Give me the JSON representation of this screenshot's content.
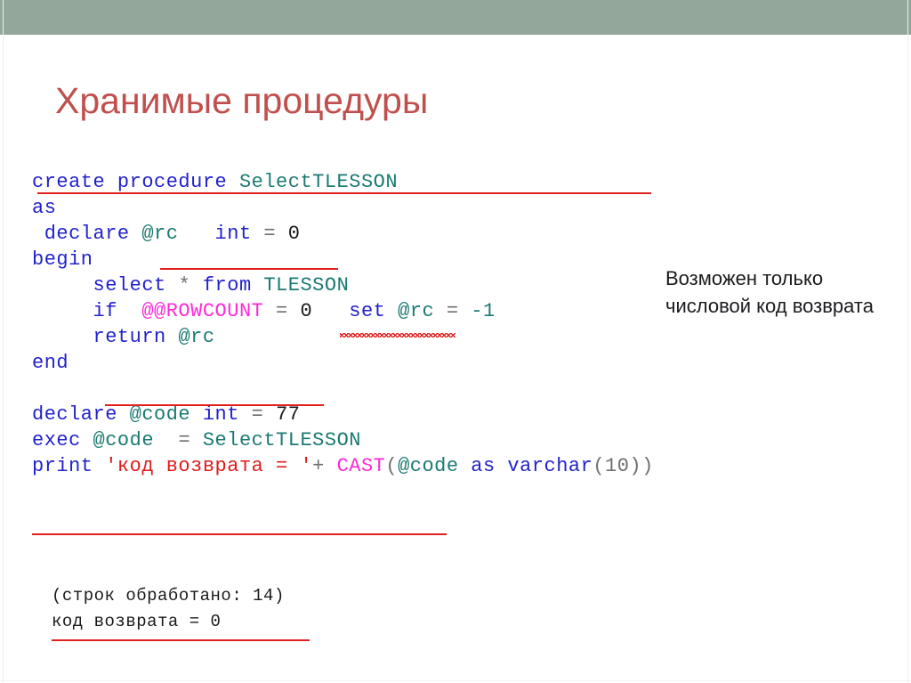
{
  "slide": {
    "title": "Хранимые процедуры",
    "title_color": "#c0504d",
    "band_color": "#93a79b",
    "background": "#ffffff"
  },
  "code": {
    "language": "T-SQL",
    "colors": {
      "keyword": "#2222cc",
      "identifier": "#1a7a72",
      "system_function": "#ff29d7",
      "string": "#e01b1b",
      "number": "#1a1a1a",
      "operator": "#6e6e6e",
      "annotation_underline": "#e02020"
    },
    "lines": [
      {
        "tokens": [
          {
            "t": "create procedure ",
            "c": "kw"
          },
          {
            "t": "SelectTLESSON",
            "c": "ident"
          }
        ]
      },
      {
        "tokens": [
          {
            "t": "as",
            "c": "kw"
          }
        ]
      },
      {
        "tokens": [
          {
            "t": " declare ",
            "c": "kw"
          },
          {
            "t": "@rc",
            "c": "ident"
          },
          {
            "t": "   ",
            "c": "num"
          },
          {
            "t": "int",
            "c": "kw"
          },
          {
            "t": " = ",
            "c": "punc"
          },
          {
            "t": "0",
            "c": "num"
          }
        ]
      },
      {
        "tokens": [
          {
            "t": "begin",
            "c": "kw"
          }
        ]
      },
      {
        "tokens": [
          {
            "t": "     select ",
            "c": "kw"
          },
          {
            "t": "* ",
            "c": "punc"
          },
          {
            "t": "from ",
            "c": "kw"
          },
          {
            "t": "TLESSON",
            "c": "ident"
          }
        ]
      },
      {
        "tokens": [
          {
            "t": "     if  ",
            "c": "kw"
          },
          {
            "t": "@@ROWCOUNT",
            "c": "sysfn"
          },
          {
            "t": " = ",
            "c": "punc"
          },
          {
            "t": "0",
            "c": "num"
          },
          {
            "t": "   ",
            "c": "num"
          },
          {
            "t": "set ",
            "c": "kw"
          },
          {
            "t": "@rc",
            "c": "ident"
          },
          {
            "t": " = ",
            "c": "punc"
          },
          {
            "t": "-1",
            "c": "ident"
          }
        ]
      },
      {
        "tokens": [
          {
            "t": "     return ",
            "c": "kw"
          },
          {
            "t": "@rc",
            "c": "ident"
          }
        ]
      },
      {
        "tokens": [
          {
            "t": "end",
            "c": "kw"
          }
        ]
      },
      {
        "tokens": []
      },
      {
        "tokens": [
          {
            "t": "declare ",
            "c": "kw"
          },
          {
            "t": "@code",
            "c": "ident"
          },
          {
            "t": " ",
            "c": "num"
          },
          {
            "t": "int",
            "c": "kw"
          },
          {
            "t": " = ",
            "c": "punc"
          },
          {
            "t": "77",
            "c": "num"
          }
        ]
      },
      {
        "tokens": [
          {
            "t": "exec ",
            "c": "kw"
          },
          {
            "t": "@code",
            "c": "ident"
          },
          {
            "t": "  ",
            "c": "num"
          },
          {
            "t": "= ",
            "c": "punc"
          },
          {
            "t": "SelectTLESSON",
            "c": "ident"
          }
        ]
      },
      {
        "tokens": [
          {
            "t": "print ",
            "c": "kw"
          },
          {
            "t": "'код возврата = '",
            "c": "str"
          },
          {
            "t": "+ ",
            "c": "punc"
          },
          {
            "t": "CAST",
            "c": "sysfn"
          },
          {
            "t": "(",
            "c": "punc"
          },
          {
            "t": "@code",
            "c": "ident"
          },
          {
            "t": " as varchar",
            "c": "kw"
          },
          {
            "t": "(10))",
            "c": "punc"
          }
        ]
      }
    ]
  },
  "output": {
    "lines": [
      "(строк обработано: 14)",
      "код возврата = 0"
    ]
  },
  "note": {
    "text": "Возможен только числовой код возврата"
  }
}
